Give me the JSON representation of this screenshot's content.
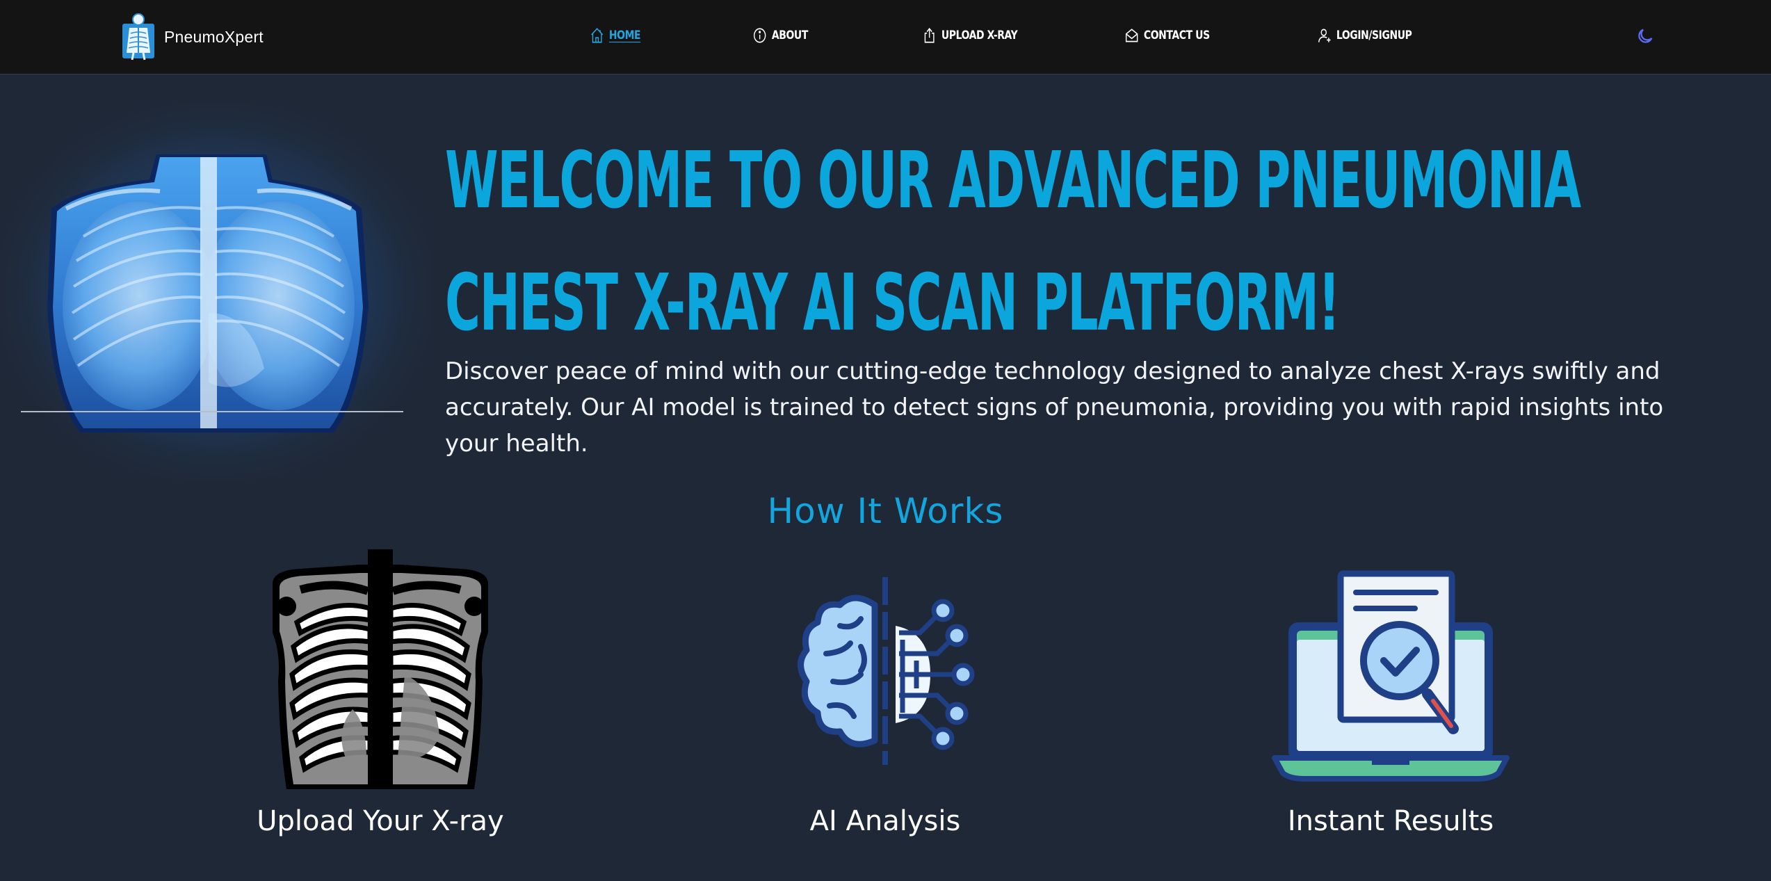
{
  "brand": {
    "name": "PneumoXpert",
    "logo_icon": "xray-body-logo-icon"
  },
  "nav": {
    "items": [
      {
        "label": "HOME",
        "icon": "home-icon",
        "active": true
      },
      {
        "label": "ABOUT",
        "icon": "info-icon",
        "active": false
      },
      {
        "label": "UPLOAD X-RAY",
        "icon": "upload-icon",
        "active": false
      },
      {
        "label": "CONTACT US",
        "icon": "mail-icon",
        "active": false
      },
      {
        "label": "LOGIN/SIGNUP",
        "icon": "user-icon",
        "active": false
      }
    ],
    "theme_toggle_icon": "moon-icon"
  },
  "hero": {
    "title": "WELCOME TO OUR ADVANCED PNEUMONIA CHEST X-RAY AI SCAN PLATFORM!",
    "description": "Discover peace of mind with our cutting-edge technology designed to analyze chest X-rays swiftly and accurately. Our AI model is trained to detect signs of pneumonia, providing you with rapid insights into your health."
  },
  "how_it_works": {
    "title": "How It Works",
    "steps": [
      {
        "label": "Upload Your X-ray",
        "icon": "chest-xray-icon"
      },
      {
        "label": "AI Analysis",
        "icon": "ai-brain-icon"
      },
      {
        "label": "Instant Results",
        "icon": "report-magnifier-icon"
      }
    ]
  },
  "colors": {
    "accent": "#0aa6dc",
    "navbar_bg": "#141414",
    "page_bg": "#1f2837",
    "theme_toggle": "#5b6cf0"
  }
}
